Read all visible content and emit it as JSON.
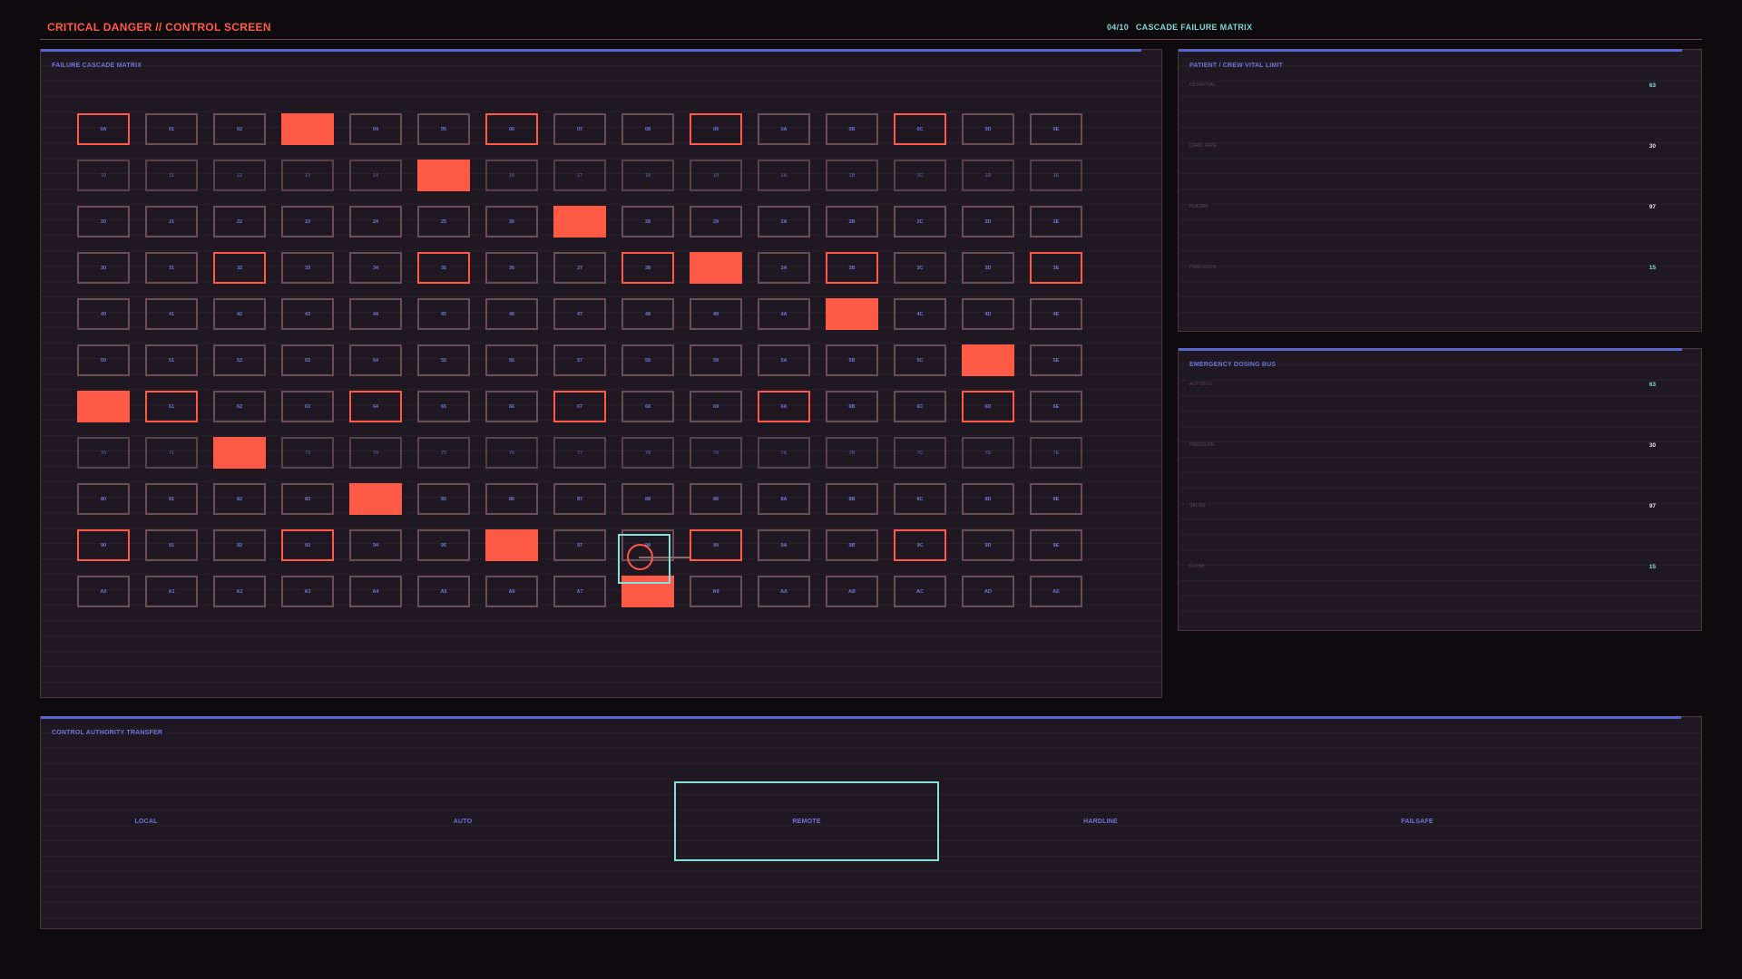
{
  "header": {
    "title": "CRITICAL DANGER // CONTROL SCREEN",
    "screen_counter": "04/10",
    "screen_name": "CASCADE FAILURE MATRIX"
  },
  "colors": {
    "background": "#0f0a0e",
    "panel": "#1f1721",
    "danger": "#ff5a45",
    "accent_blue": "#5a66c9",
    "accent_cyan": "#86e0da"
  },
  "matrix": {
    "title": "FAILURE CASCADE MATRIX",
    "columns": 15,
    "rows": [
      {
        "prefix": "0",
        "cells": [
          "0A",
          "01",
          "02",
          "03",
          "04",
          "05",
          "06",
          "07",
          "08",
          "09",
          "0A",
          "0B",
          "0C",
          "0D",
          "0E"
        ]
      },
      {
        "prefix": "1",
        "cells": [
          "10",
          "11",
          "12",
          "13",
          "14",
          "15",
          "16",
          "17",
          "18",
          "19",
          "1A",
          "1B",
          "1C",
          "1D",
          "1E"
        ]
      },
      {
        "prefix": "2",
        "cells": [
          "20",
          "21",
          "22",
          "23",
          "24",
          "25",
          "26",
          "27",
          "28",
          "29",
          "2A",
          "2B",
          "2C",
          "2D",
          "2E"
        ]
      },
      {
        "prefix": "3",
        "cells": [
          "30",
          "31",
          "32",
          "33",
          "34",
          "35",
          "36",
          "37",
          "38",
          "39",
          "3A",
          "3B",
          "3C",
          "3D",
          "3E"
        ]
      },
      {
        "prefix": "4",
        "cells": [
          "40",
          "41",
          "42",
          "43",
          "44",
          "45",
          "46",
          "47",
          "48",
          "49",
          "4A",
          "4B",
          "4C",
          "4D",
          "4E"
        ]
      },
      {
        "prefix": "5",
        "cells": [
          "50",
          "51",
          "52",
          "53",
          "54",
          "55",
          "56",
          "57",
          "58",
          "59",
          "5A",
          "5B",
          "5C",
          "5D",
          "5E"
        ]
      },
      {
        "prefix": "6",
        "cells": [
          "60",
          "61",
          "62",
          "63",
          "64",
          "65",
          "66",
          "67",
          "68",
          "69",
          "6A",
          "6B",
          "6C",
          "6D",
          "6E"
        ]
      },
      {
        "prefix": "7",
        "cells": [
          "70",
          "71",
          "72",
          "73",
          "74",
          "75",
          "76",
          "77",
          "78",
          "79",
          "7A",
          "7B",
          "7C",
          "7D",
          "7E"
        ]
      },
      {
        "prefix": "8",
        "cells": [
          "80",
          "81",
          "82",
          "83",
          "84",
          "85",
          "86",
          "87",
          "88",
          "89",
          "8A",
          "8B",
          "8C",
          "8D",
          "8E"
        ]
      },
      {
        "prefix": "9",
        "cells": [
          "90",
          "91",
          "92",
          "93",
          "94",
          "95",
          "96",
          "97",
          "98",
          "99",
          "9A",
          "9B",
          "9C",
          "9D",
          "9E"
        ]
      },
      {
        "prefix": "A",
        "cells": [
          "A0",
          "A1",
          "A2",
          "A3",
          "A4",
          "A5",
          "A6",
          "A7",
          "A8",
          "A9",
          "AA",
          "AB",
          "AC",
          "AD",
          "AE"
        ]
      }
    ],
    "states": [
      [
        "warn",
        "normal",
        "normal",
        "fail",
        "normal",
        "normal",
        "warn",
        "normal",
        "normal",
        "warn",
        "normal",
        "normal",
        "warn",
        "normal",
        "normal"
      ],
      [
        "dim",
        "dim",
        "dim",
        "dim",
        "dim",
        "fail",
        "dim",
        "dim",
        "dim",
        "dim",
        "dim",
        "dim",
        "dim",
        "dim",
        "dim"
      ],
      [
        "normal",
        "normal",
        "normal",
        "normal",
        "normal",
        "normal",
        "normal",
        "fail",
        "normal",
        "normal",
        "normal",
        "normal",
        "normal",
        "normal",
        "normal"
      ],
      [
        "normal",
        "normal",
        "warn",
        "normal",
        "normal",
        "warn",
        "normal",
        "normal",
        "warn",
        "fail",
        "normal",
        "warn",
        "normal",
        "normal",
        "warn"
      ],
      [
        "normal",
        "normal",
        "normal",
        "normal",
        "normal",
        "normal",
        "normal",
        "normal",
        "normal",
        "normal",
        "normal",
        "fail",
        "normal",
        "normal",
        "normal"
      ],
      [
        "normal",
        "normal",
        "normal",
        "normal",
        "normal",
        "normal",
        "normal",
        "normal",
        "normal",
        "normal",
        "normal",
        "normal",
        "normal",
        "fail",
        "normal"
      ],
      [
        "fail",
        "warn",
        "normal",
        "normal",
        "warn",
        "normal",
        "normal",
        "warn",
        "normal",
        "normal",
        "warn",
        "normal",
        "normal",
        "warn",
        "normal"
      ],
      [
        "dim",
        "dim",
        "fail",
        "dim",
        "dim",
        "dim",
        "dim",
        "dim",
        "dim",
        "dim",
        "dim",
        "dim",
        "dim",
        "dim",
        "dim"
      ],
      [
        "normal",
        "normal",
        "normal",
        "normal",
        "fail",
        "normal",
        "normal",
        "normal",
        "normal",
        "normal",
        "normal",
        "normal",
        "normal",
        "normal",
        "normal"
      ],
      [
        "warn",
        "normal",
        "normal",
        "warn",
        "normal",
        "normal",
        "fail",
        "normal",
        "normal",
        "warn",
        "normal",
        "normal",
        "warn",
        "normal",
        "normal"
      ],
      [
        "normal",
        "normal",
        "normal",
        "normal",
        "normal",
        "normal",
        "normal",
        "normal",
        "fail",
        "normal",
        "normal",
        "normal",
        "normal",
        "normal",
        "normal"
      ]
    ]
  },
  "vitals": {
    "title": "PATIENT / CREW VITAL LIMIT",
    "items": [
      {
        "label": "O2 PARTIAL",
        "value": "63"
      },
      {
        "label": "CARD. RATE",
        "value": "30"
      },
      {
        "label": "PLASMA",
        "value": "97"
      },
      {
        "label": "PERFUSION",
        "value": "15"
      }
    ]
  },
  "dosing": {
    "title": "EMERGENCY DOSING BUS",
    "items": [
      {
        "label": "AUTODOS",
        "value": "63"
      },
      {
        "label": "PRESSURE",
        "value": "30"
      },
      {
        "label": "SALINE",
        "value": "97"
      },
      {
        "label": "FLUSH",
        "value": "15"
      }
    ]
  },
  "authority": {
    "title": "CONTROL AUTHORITY TRANSFER",
    "modes": [
      "LOCAL",
      "AUTO",
      "REMOTE",
      "HARDLINE",
      "FAILSAFE"
    ],
    "active": "REMOTE"
  }
}
